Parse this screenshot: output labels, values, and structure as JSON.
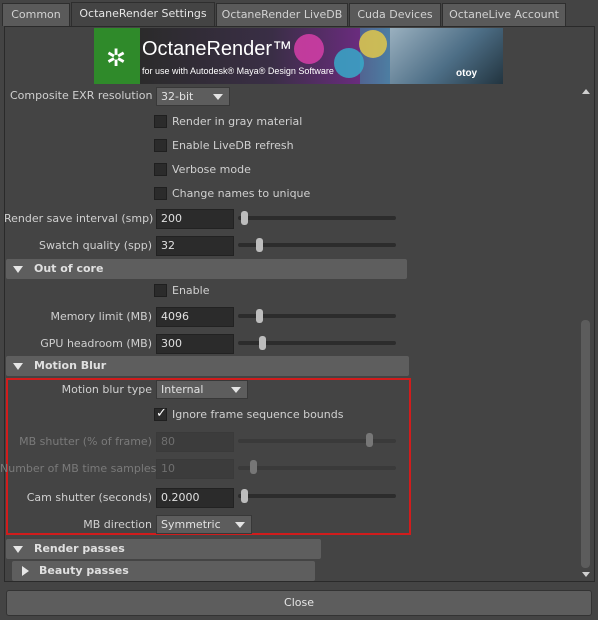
{
  "tabs": [
    "Common",
    "OctaneRender Settings",
    "OctaneRender LiveDB",
    "Cuda Devices",
    "OctaneLive Account"
  ],
  "active_tab": "OctaneRender Settings",
  "banner": {
    "brand": "OctaneRender™",
    "subtitle": "for use with Autodesk® Maya® Design Software",
    "otoy": "otoy"
  },
  "composite": {
    "label": "Composite EXR resolution",
    "value": "32-bit"
  },
  "checkboxes": {
    "gray_material": "Render in gray material",
    "livedb_refresh": "Enable LiveDB refresh",
    "verbose": "Verbose mode",
    "unique_names": "Change names to unique"
  },
  "render_save": {
    "label": "Render save interval (smp)",
    "value": "200",
    "fraction": 0.02
  },
  "swatch": {
    "label": "Swatch quality (spp)",
    "value": "32",
    "fraction": 0.12
  },
  "out_of_core": {
    "title": "Out of core",
    "enable_label": "Enable",
    "memory": {
      "label": "Memory limit (MB)",
      "value": "4096",
      "fraction": 0.12
    },
    "gpu": {
      "label": "GPU headroom (MB)",
      "value": "300",
      "fraction": 0.14
    }
  },
  "motion_blur": {
    "title": "Motion Blur",
    "type": {
      "label": "Motion blur type",
      "value": "Internal"
    },
    "ignore_bounds": {
      "label": "Ignore frame sequence bounds",
      "checked": true
    },
    "mb_shutter": {
      "label": "MB shutter (% of frame)",
      "value": "80",
      "fraction": 0.85
    },
    "time_samples": {
      "label": "Number of MB time samples",
      "value": "10",
      "fraction": 0.08
    },
    "cam_shutter": {
      "label": "Cam shutter (seconds)",
      "value": "0.2000",
      "fraction": 0.02
    },
    "direction": {
      "label": "MB direction",
      "value": "Symmetric"
    }
  },
  "render_passes": {
    "title": "Render passes"
  },
  "beauty_passes": {
    "title": "Beauty passes"
  },
  "close_button": "Close"
}
